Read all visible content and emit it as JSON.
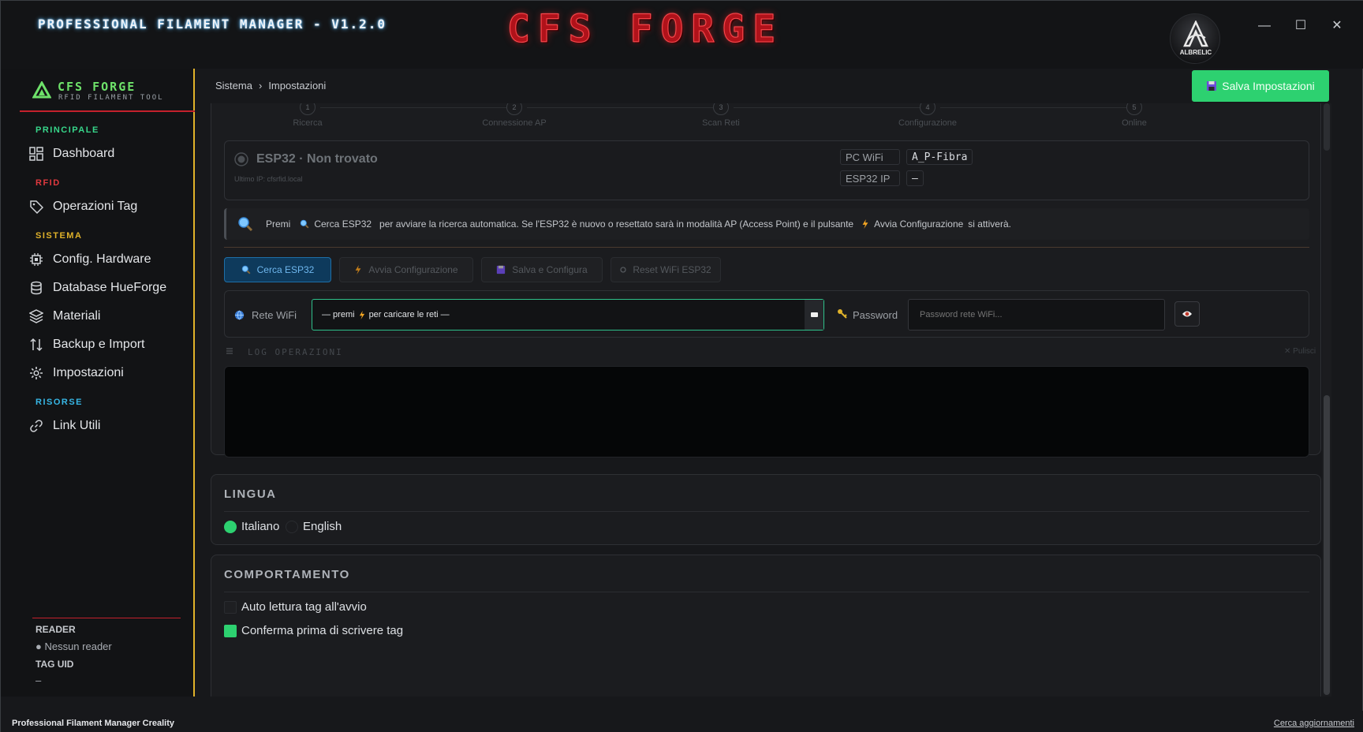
{
  "window": {
    "app_title": "PROFESSIONAL FILAMENT MANAGER - V1.2.0",
    "brand_logo": "CFS FORGE",
    "avatar_label": "ALBRELIC",
    "minimize": "—",
    "maximize": "☐",
    "close": "✕"
  },
  "sidebar": {
    "brand": "CFS FORGE",
    "subtitle": "RFID FILAMENT TOOL",
    "sections": {
      "principale": "PRINCIPALE",
      "rfid": "RFID",
      "sistema": "SISTEMA",
      "risorse": "RISORSE"
    },
    "items": [
      {
        "label": "Dashboard",
        "icon": "dashboard-icon"
      },
      {
        "label": "Operazioni Tag",
        "icon": "tag-icon"
      },
      {
        "label": "Config. Hardware",
        "icon": "chip-icon"
      },
      {
        "label": "Database HueForge",
        "icon": "database-icon"
      },
      {
        "label": "Materiali",
        "icon": "layers-icon"
      },
      {
        "label": "Backup e Import",
        "icon": "swap-icon"
      },
      {
        "label": "Impostazioni",
        "icon": "gear-icon"
      },
      {
        "label": "Link Utili",
        "icon": "link-icon"
      }
    ],
    "reader_title": "READER",
    "reader_value": "● Nessun reader",
    "tag_uid_title": "TAG UID",
    "tag_uid_value": "–"
  },
  "breadcrumb": {
    "root": "Sistema",
    "sep": "›",
    "current": "Impostazioni"
  },
  "save_button": "Salva Impostazioni",
  "wizard": {
    "steps": [
      {
        "n": "1",
        "label": "Ricerca"
      },
      {
        "n": "2",
        "label": "Connessione AP"
      },
      {
        "n": "3",
        "label": "Scan Reti"
      },
      {
        "n": "4",
        "label": "Configurazione"
      },
      {
        "n": "5",
        "label": "Online"
      }
    ],
    "esp_title": "ESP32 · Non trovato",
    "esp_sub": "Ultimo IP: cfsrfid.local",
    "pc_wifi_label": "PC WiFi",
    "pc_wifi_value": "A_P-Fibra",
    "esp_ip_label": "ESP32 IP",
    "esp_ip_value": "—",
    "info": {
      "premi": "Premi",
      "cerca": "Cerca ESP32",
      "text": "per avviare la ricerca automatica. Se l'ESP32 è nuovo o resettato sarà in modalità AP (Access Point) e il pulsante",
      "avvia": "Avvia Configurazione",
      "end": "si attiverà."
    },
    "buttons": {
      "cerca": "Cerca ESP32",
      "avvia": "Avvia Configurazione",
      "salva": "Salva e Configura",
      "reset": "Reset WiFi ESP32"
    },
    "rete_label": "Rete WiFi",
    "select_pre": "— premi",
    "select_post": "per caricare le reti —",
    "password_label": "Password",
    "password_placeholder": "Password rete WiFi...",
    "log_title": "LOG OPERAZIONI",
    "log_clear": "✕ Pulisci"
  },
  "lingua": {
    "title": "LINGUA",
    "options": [
      "Italiano",
      "English"
    ],
    "selected": "Italiano"
  },
  "comportamento": {
    "title": "COMPORTAMENTO",
    "options": [
      {
        "label": "Auto lettura tag all'avvio",
        "checked": false
      },
      {
        "label": "Conferma prima di scrivere tag",
        "checked": true
      }
    ]
  },
  "status": {
    "left": "Professional Filament Manager Creality",
    "right": "Cerca aggiornamenti"
  },
  "colors": {
    "accent_green": "#2dd170",
    "brand_red": "#b0121a",
    "sidebar_border": "#e0b22a"
  }
}
